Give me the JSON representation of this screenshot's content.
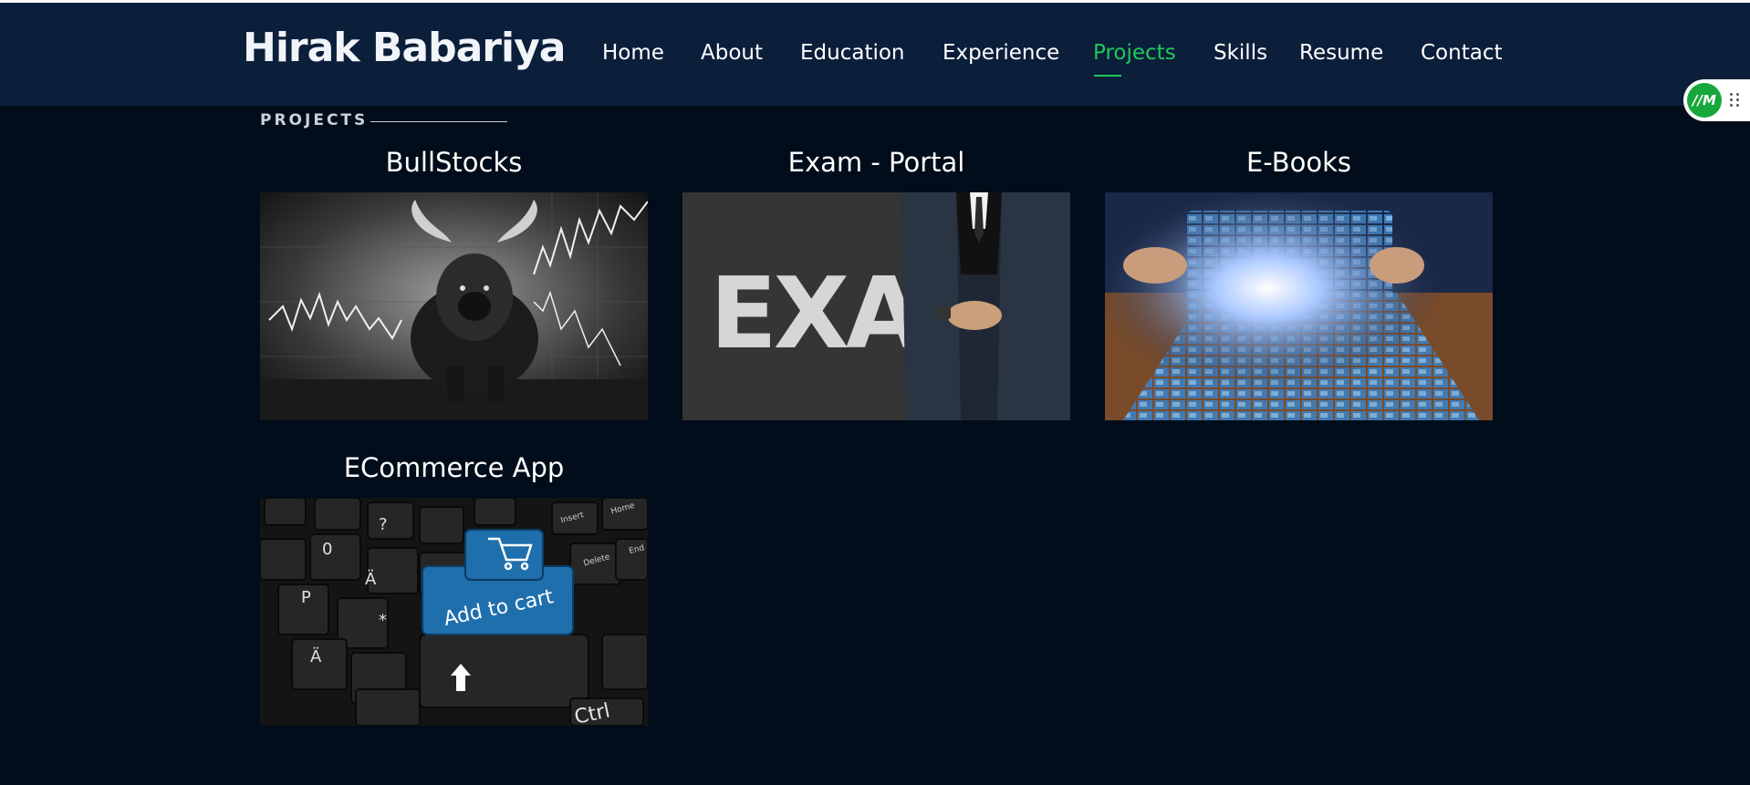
{
  "header": {
    "brand": "Hirak Babariya",
    "nav": [
      {
        "label": "Home",
        "active": false
      },
      {
        "label": "About",
        "active": false
      },
      {
        "label": "Education",
        "active": false
      },
      {
        "label": "Experience",
        "active": false
      },
      {
        "label": "Projects",
        "active": true
      },
      {
        "label": "Skills",
        "active": false
      },
      {
        "label": "Resume",
        "active": false
      },
      {
        "label": "Contact",
        "active": false
      }
    ]
  },
  "extension": {
    "logo_text": "//M",
    "icon": "grip-dots-icon"
  },
  "section": {
    "label": "PROJECTS"
  },
  "projects": [
    {
      "title": "BullStocks",
      "image": "bull-stock-market-image"
    },
    {
      "title": "Exam - Portal",
      "image": "exam-chalkboard-businessman-image"
    },
    {
      "title": "E-Books",
      "image": "tablet-media-grid-image"
    },
    {
      "title": "ECommerce App",
      "image": "keyboard-add-to-cart-image"
    }
  ],
  "image_texts": {
    "exam_word": "EXAM",
    "cart_key": "Add to cart",
    "ctrl_key": "Ctrl",
    "insert_key": "Insert",
    "home_key": "Home",
    "delete_key": "Delete",
    "end_key": "End"
  },
  "colors": {
    "page_bg": "#010d1a",
    "header_bg": "#0b1e3a",
    "accent": "#1fc95a",
    "text": "#ffffff"
  }
}
